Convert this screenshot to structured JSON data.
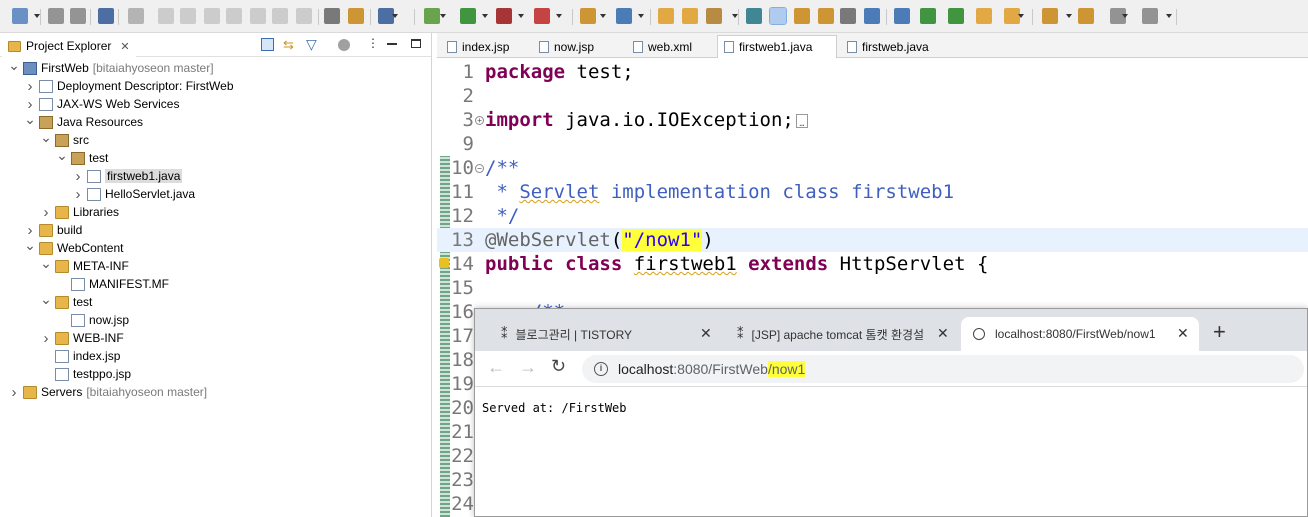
{
  "toolbar": {
    "icons": [
      "new-wizard-icon",
      "save-icon",
      "save-all-icon",
      "terminal-icon",
      "skip-breakpoints-icon",
      "resume-icon",
      "suspend-icon",
      "terminate-icon",
      "disconnect-icon",
      "step-into-icon",
      "step-over-icon",
      "step-return-icon",
      "console-icon",
      "drop-to-frame-icon",
      "build-icon",
      "debug-icon",
      "run-icon",
      "coverage-icon",
      "external-tools-icon",
      "new-java-project-icon",
      "new-class-icon",
      "open-type-icon",
      "open-folder-icon",
      "search-icon",
      "annotation-icon",
      "highlight-icon",
      "toggle-mark-icon",
      "java-doc-icon",
      "show-whitespace-icon",
      "globe-icon",
      "web-browser-icon",
      "run-server-icon",
      "stop-server-icon",
      "next-annotation-icon",
      "previous-annotation-icon",
      "last-edit-icon",
      "back-icon",
      "forward-icon",
      "perspective-icon"
    ]
  },
  "explorer": {
    "title": "Project Explorer",
    "tree": [
      {
        "label": "FirstWeb",
        "suffix": "[bitaiahyoseon master]",
        "icon": "project-icon",
        "expanded": true
      },
      {
        "label": "Deployment Descriptor: FirstWeb",
        "icon": "deployment-descriptor-icon",
        "expanded": false
      },
      {
        "label": "JAX-WS Web Services",
        "icon": "web-services-icon",
        "expanded": false
      },
      {
        "label": "Java Resources",
        "icon": "java-resources-icon",
        "expanded": true
      },
      {
        "label": "src",
        "icon": "source-folder-icon",
        "expanded": true
      },
      {
        "label": "test",
        "icon": "package-icon",
        "expanded": true
      },
      {
        "label": "firstweb1.java",
        "icon": "java-file-icon",
        "expanded": false
      },
      {
        "label": "HelloServlet.java",
        "icon": "java-file-icon",
        "expanded": false
      },
      {
        "label": "Libraries",
        "icon": "libraries-icon",
        "expanded": false
      },
      {
        "label": "build",
        "icon": "folder-icon",
        "expanded": false
      },
      {
        "label": "WebContent",
        "icon": "folder-icon",
        "expanded": true
      },
      {
        "label": "META-INF",
        "icon": "folder-icon",
        "expanded": true
      },
      {
        "label": "MANIFEST.MF",
        "icon": "file-icon"
      },
      {
        "label": "test",
        "icon": "folder-icon",
        "expanded": true
      },
      {
        "label": "now.jsp",
        "icon": "jsp-file-icon"
      },
      {
        "label": "WEB-INF",
        "icon": "folder-icon",
        "expanded": false
      },
      {
        "label": "index.jsp",
        "icon": "jsp-file-icon"
      },
      {
        "label": "testppo.jsp",
        "icon": "jsp-file-icon"
      },
      {
        "label": "Servers",
        "suffix": "[bitaiahyoseon master]",
        "icon": "servers-icon",
        "expanded": false
      }
    ]
  },
  "editor": {
    "tabs": [
      "index.jsp",
      "now.jsp",
      "web.xml",
      "firstweb1.java",
      "firstweb.java"
    ],
    "active_tab": "firstweb1.java",
    "lines": [
      {
        "n": "1",
        "text": "package test;"
      },
      {
        "n": "2",
        "text": ""
      },
      {
        "n": "3",
        "text": "import java.io.IOException;"
      },
      {
        "n": "9",
        "text": ""
      },
      {
        "n": "10",
        "text": "/**"
      },
      {
        "n": "11",
        "text": " * Servlet implementation class firstweb1"
      },
      {
        "n": "12",
        "text": " */"
      },
      {
        "n": "13",
        "text": "@WebServlet(\"/now1\")"
      },
      {
        "n": "14",
        "text": "public class firstweb1 extends HttpServlet {"
      },
      {
        "n": "15",
        "text": ""
      },
      {
        "n": "16",
        "text": "    /**"
      },
      {
        "n": "17",
        "text": ""
      },
      {
        "n": "18",
        "text": ""
      },
      {
        "n": "19",
        "text": ""
      },
      {
        "n": "20",
        "text": ""
      },
      {
        "n": "21",
        "text": ""
      },
      {
        "n": "22",
        "text": ""
      },
      {
        "n": "23",
        "text": ""
      },
      {
        "n": "24",
        "text": ""
      }
    ]
  },
  "browser": {
    "tabs": [
      "블로그관리 | TISTORY",
      "[JSP] apache tomcat 톰캣 환경설",
      "localhost:8080/FirstWeb/now1"
    ],
    "url_host": "localhost",
    "url_rest": ":8080/FirstWeb",
    "url_path": "/now1",
    "content": "Served at: /FirstWeb"
  },
  "colors": {
    "keyword": "#7f0055",
    "javadoc": "#3f5fbf",
    "string": "#2a00ff",
    "annotation": "#646464",
    "highlight": "#ffff3a",
    "current_line": "#e8f2fe"
  }
}
